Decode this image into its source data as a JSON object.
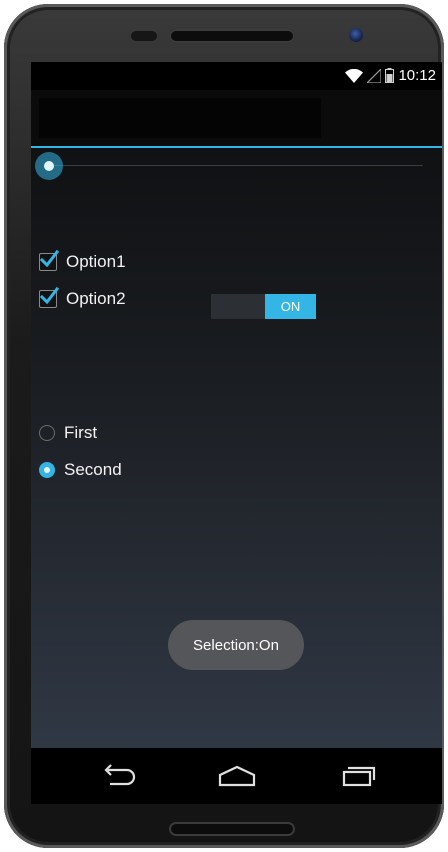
{
  "status_bar": {
    "time": "10:12",
    "icons": [
      "wifi-icon",
      "signal-icon",
      "battery-icon"
    ]
  },
  "options": [
    {
      "label": "Option1",
      "checked": true
    },
    {
      "label": "Option2",
      "checked": true
    }
  ],
  "seekbar": {
    "value": 0
  },
  "switch": {
    "label": "ON",
    "state": "on"
  },
  "radios": [
    {
      "label": "First",
      "selected": false
    },
    {
      "label": "Second",
      "selected": true
    }
  ],
  "toast": {
    "text": "Selection:On"
  },
  "nav_bar": {
    "buttons": [
      "back-icon",
      "home-icon",
      "recents-icon"
    ]
  },
  "colors": {
    "accent": "#33b5e5",
    "background_top": "#101113",
    "background_bottom": "#303845",
    "toast": "#555659"
  }
}
